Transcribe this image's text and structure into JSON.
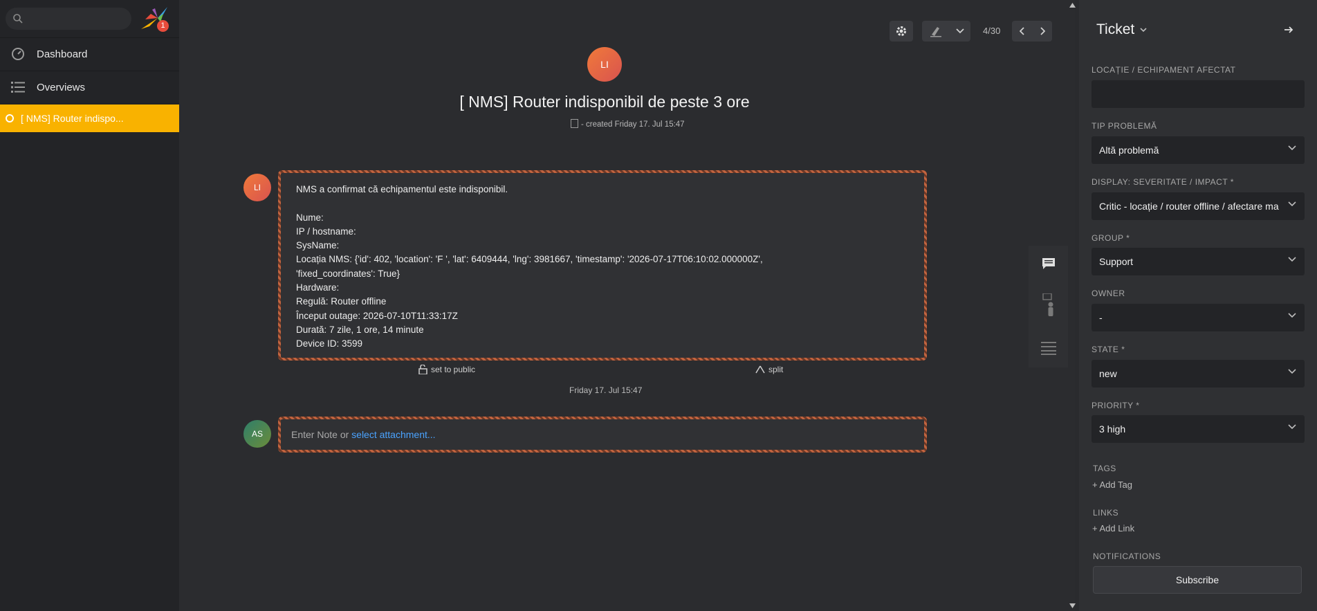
{
  "nav": {
    "search": {
      "placeholder": ""
    },
    "logo_badge": "1",
    "items": [
      {
        "label": "Dashboard",
        "icon": "dashboard-icon"
      },
      {
        "label": "Overviews",
        "icon": "list-icon"
      }
    ],
    "open_ticket": {
      "label": "[ NMS] Router indispo..."
    }
  },
  "toolbar": {
    "pager": "4/30"
  },
  "ticket": {
    "customer_initials": "LI",
    "title": "[ NMS] Router indisponibil de peste 3 ore",
    "created": "- created Friday 17. Jul 15:47"
  },
  "article": {
    "author_initials": "LI",
    "body": "NMS a confirmat că echipamentul este indisponibil.\n\nNume:\nIP / hostname:\nSysName:\nLocația NMS: {'id': 402, 'location': 'F ', 'lat': 6409444, 'lng': 3981667, 'timestamp': '2026-07-17T06:10:02.000000Z',\n'fixed_coordinates': True}\nHardware:\nRegulă: Router offline\nÎnceput outage: 2026-07-10T11:33:17Z\nDurată: 7 zile, 1 ore, 14 minute\nDevice ID: 3599",
    "set_public": "set to public",
    "split": "split",
    "date": "Friday 17. Jul 15:47"
  },
  "note": {
    "author_initials": "AS",
    "placeholder_prefix": "Enter Note or ",
    "attachment_link": "select attachment..."
  },
  "sidebar": {
    "title": "Ticket",
    "fields": [
      {
        "label": "LOCAȚIE / ECHIPAMENT AFECTAT",
        "value": ""
      },
      {
        "label": "TIP PROBLEMĂ",
        "value": "Altă problemă"
      },
      {
        "label": "DISPLAY: SEVERITATE / IMPACT *",
        "value": "Critic - locație / router offline / afectare ma"
      },
      {
        "label": "GROUP *",
        "value": "Support"
      },
      {
        "label": "OWNER",
        "value": "-"
      },
      {
        "label": "STATE *",
        "value": "new"
      },
      {
        "label": "PRIORITY *",
        "value": "3 high"
      }
    ],
    "tags_label": "TAGS",
    "add_tag": "+ Add Tag",
    "links_label": "LINKS",
    "add_link": "+ Add Link",
    "notifications_label": "NOTIFICATIONS",
    "subscribe": "Subscribe"
  },
  "colors": {
    "accent": "#f9b200",
    "link": "#4aa3ff",
    "customer_avatar": "#e5683f",
    "agent_avatar": "#3d7a55"
  }
}
